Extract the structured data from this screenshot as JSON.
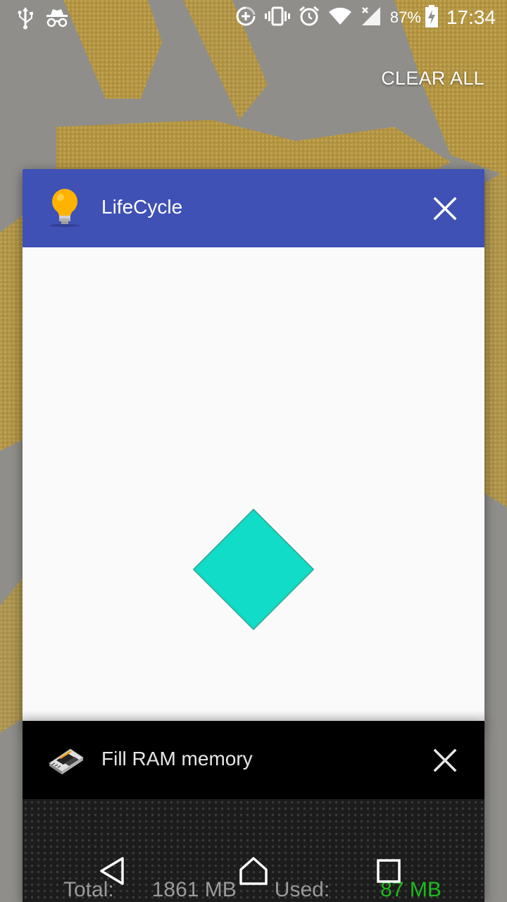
{
  "status_bar": {
    "left_icons": [
      "usb-icon",
      "incognito-icon"
    ],
    "right_icons": [
      "data-saver-icon",
      "vibrate-icon",
      "alarm-icon",
      "wifi-icon",
      "signal-icon",
      "battery-charging-icon"
    ],
    "battery_percent": "87%",
    "time": "17:34"
  },
  "recents": {
    "clear_all_label": "CLEAR ALL"
  },
  "tasks": [
    {
      "title": "LifeCycle",
      "icon": "lightbulb-icon",
      "header_color": "#3f51b5",
      "content_shape_color": "#10dcc8"
    },
    {
      "title": "Fill RAM memory",
      "icon": "ram-chip-icon",
      "header_color": "#000000",
      "total_label": "Total:",
      "total_value": "1861 MB",
      "used_label": "Used:",
      "used_value": "87 MB",
      "used_color": "#1fb81f"
    }
  ],
  "nav_bar": {
    "buttons": [
      "back-icon",
      "home-icon",
      "recents-icon"
    ]
  },
  "colors": {
    "wallpaper_gray": "#8f8e8b",
    "wallpaper_gold": "#b8963a"
  }
}
